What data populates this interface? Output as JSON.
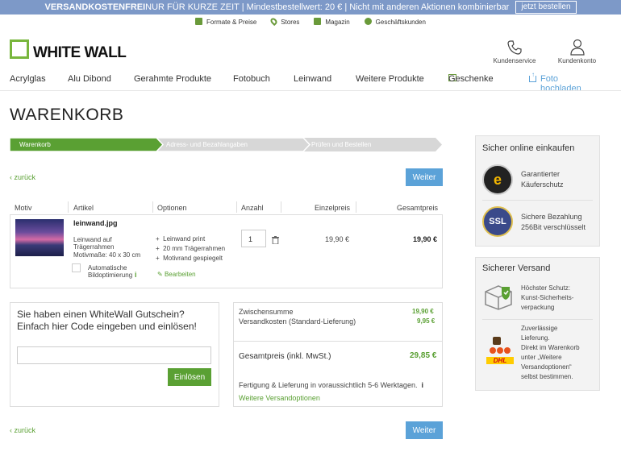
{
  "promo": {
    "bold": "VERSANDKOSTENFREI",
    "text": " NUR FÜR KURZE ZEIT | Mindestbestellwert: 20 € | Nicht mit anderen Aktionen kombinierbar",
    "button": "jetzt bestellen"
  },
  "service_links": [
    "Formate & Preise",
    "Stores",
    "Magazin",
    "Geschäftskunden"
  ],
  "logo": "WHITE WALL",
  "header_icons": {
    "service": "Kundenservice",
    "account": "Kundenkonto"
  },
  "nav": {
    "items": [
      "Acrylglas",
      "Alu Dibond",
      "Gerahmte Produkte",
      "Fotobuch",
      "Leinwand",
      "Weitere Produkte"
    ],
    "gifts": "Geschenke",
    "upload": "Foto hochladen"
  },
  "page_title": "WARENKORB",
  "steps": [
    "Warenkorb",
    "Adress- und Bezahlangaben",
    "Prüfen und Bestellen"
  ],
  "back_label": "zurück",
  "next_label": "Weiter",
  "table": {
    "headers": [
      "Motiv",
      "Artikel",
      "Optionen",
      "Anzahl",
      "Einzelpreis",
      "Gesamtpreis"
    ],
    "item": {
      "filename": "leinwand.jpg",
      "article_lines": [
        "Leinwand auf",
        "Trägerrahmen",
        "Motivmaße: 40 x 30 cm"
      ],
      "auto_opt": [
        "Automatische",
        "Bildoptimierung"
      ],
      "options": [
        "Leinwand print",
        "20 mm Trägerrahmen",
        "Motivrand gespiegelt"
      ],
      "edit": "Bearbeiten",
      "quantity": "1",
      "unit_price": "19,90 €",
      "total_price": "19,90 €"
    }
  },
  "voucher": {
    "title": "Sie haben einen WhiteWall Gutschein? Einfach hier Code eingeben und einlösen!",
    "placeholder": "",
    "button": "Einlösen"
  },
  "summary": {
    "subtotal_label": "Zwischensumme",
    "subtotal": "19,90 €",
    "shipping_label": "Versandkosten (Standard-Lieferung)",
    "shipping": "9,95 €",
    "total_label": "Gesamtpreis (inkl. MwSt.)",
    "total": "29,85 €",
    "delivery": "Fertigung & Lieferung in voraussichtlich 5-6 Werktagen.",
    "more_shipping": "Weitere Versandoptionen"
  },
  "secure": {
    "title": "Sicher online einkaufen",
    "items": [
      {
        "text": [
          "Garantierter",
          "Käuferschutz"
        ]
      },
      {
        "text": [
          "Sichere Bezahlung",
          "256Bit verschlüsselt"
        ]
      }
    ]
  },
  "shipping_box": {
    "title": "Sicherer Versand",
    "protect": [
      "Höchster Schutz:",
      "Kunst-Sicherheits-",
      "verpackung"
    ],
    "delivery": [
      "Zuverlässige",
      "Lieferung.",
      "Direkt im Warenkorb",
      "unter „Weitere",
      "Versandoptionen“",
      "selbst bestimmen."
    ]
  },
  "colors": {
    "green": "#5aa033",
    "blue": "#5ba2d8",
    "promo": "#7d99c8"
  }
}
